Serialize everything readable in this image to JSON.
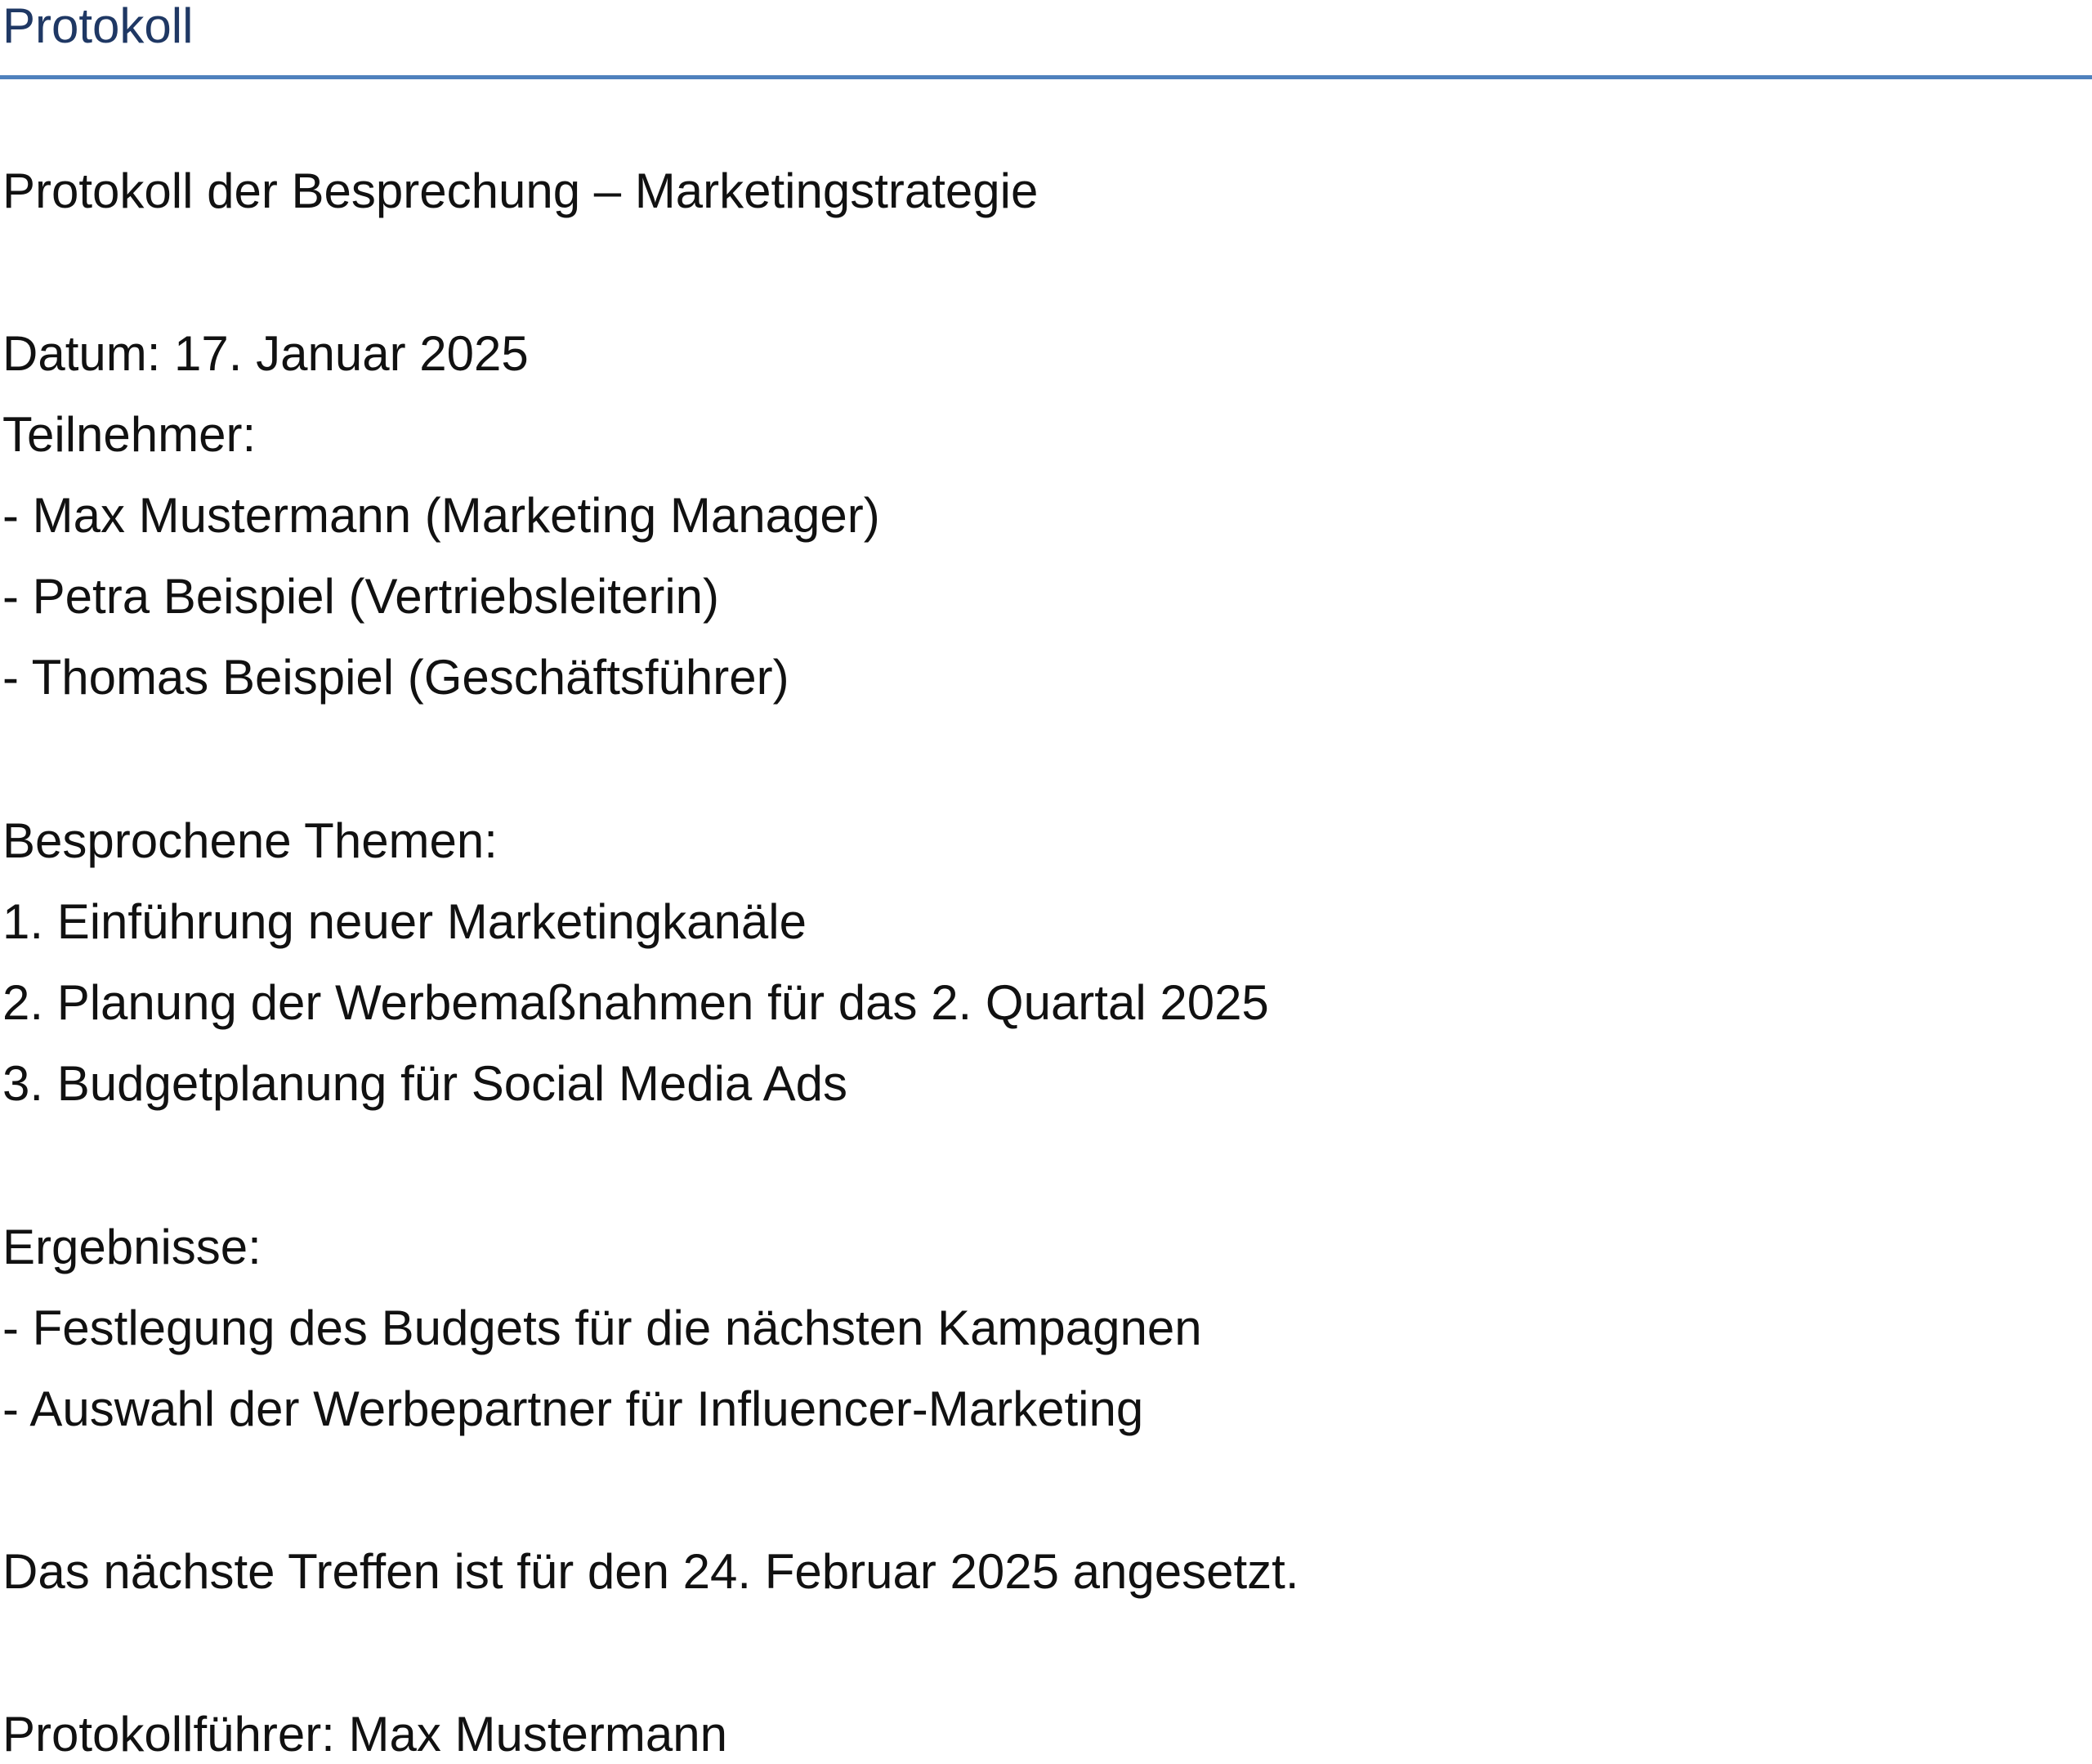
{
  "document": {
    "title": "Protokoll",
    "heading": "Protokoll der Besprechung – Marketingstrategie",
    "date_line": "Datum: 17. Januar 2025",
    "participants": {
      "label": "Teilnehmer:",
      "items": [
        "- Max Mustermann (Marketing Manager)",
        "- Petra Beispiel (Vertriebsleiterin)",
        "- Thomas Beispiel (Geschäftsführer)"
      ]
    },
    "topics": {
      "label": "Besprochene Themen:",
      "items": [
        "1. Einführung neuer Marketingkanäle",
        "2. Planung der Werbemaßnahmen für das 2. Quartal 2025",
        "3. Budgetplanung für Social Media Ads"
      ]
    },
    "results": {
      "label": "Ergebnisse:",
      "items": [
        "- Festlegung des Budgets für die nächsten Kampagnen",
        "- Auswahl der Werbepartner für Influencer-Marketing"
      ]
    },
    "next_meeting": "Das nächste Treffen ist für den 24. Februar 2025 angesetzt.",
    "recorder": "Protokollführer: Max Mustermann"
  },
  "colors": {
    "title": "#1f3864",
    "rule": "#4f81bd",
    "text": "#111111"
  }
}
